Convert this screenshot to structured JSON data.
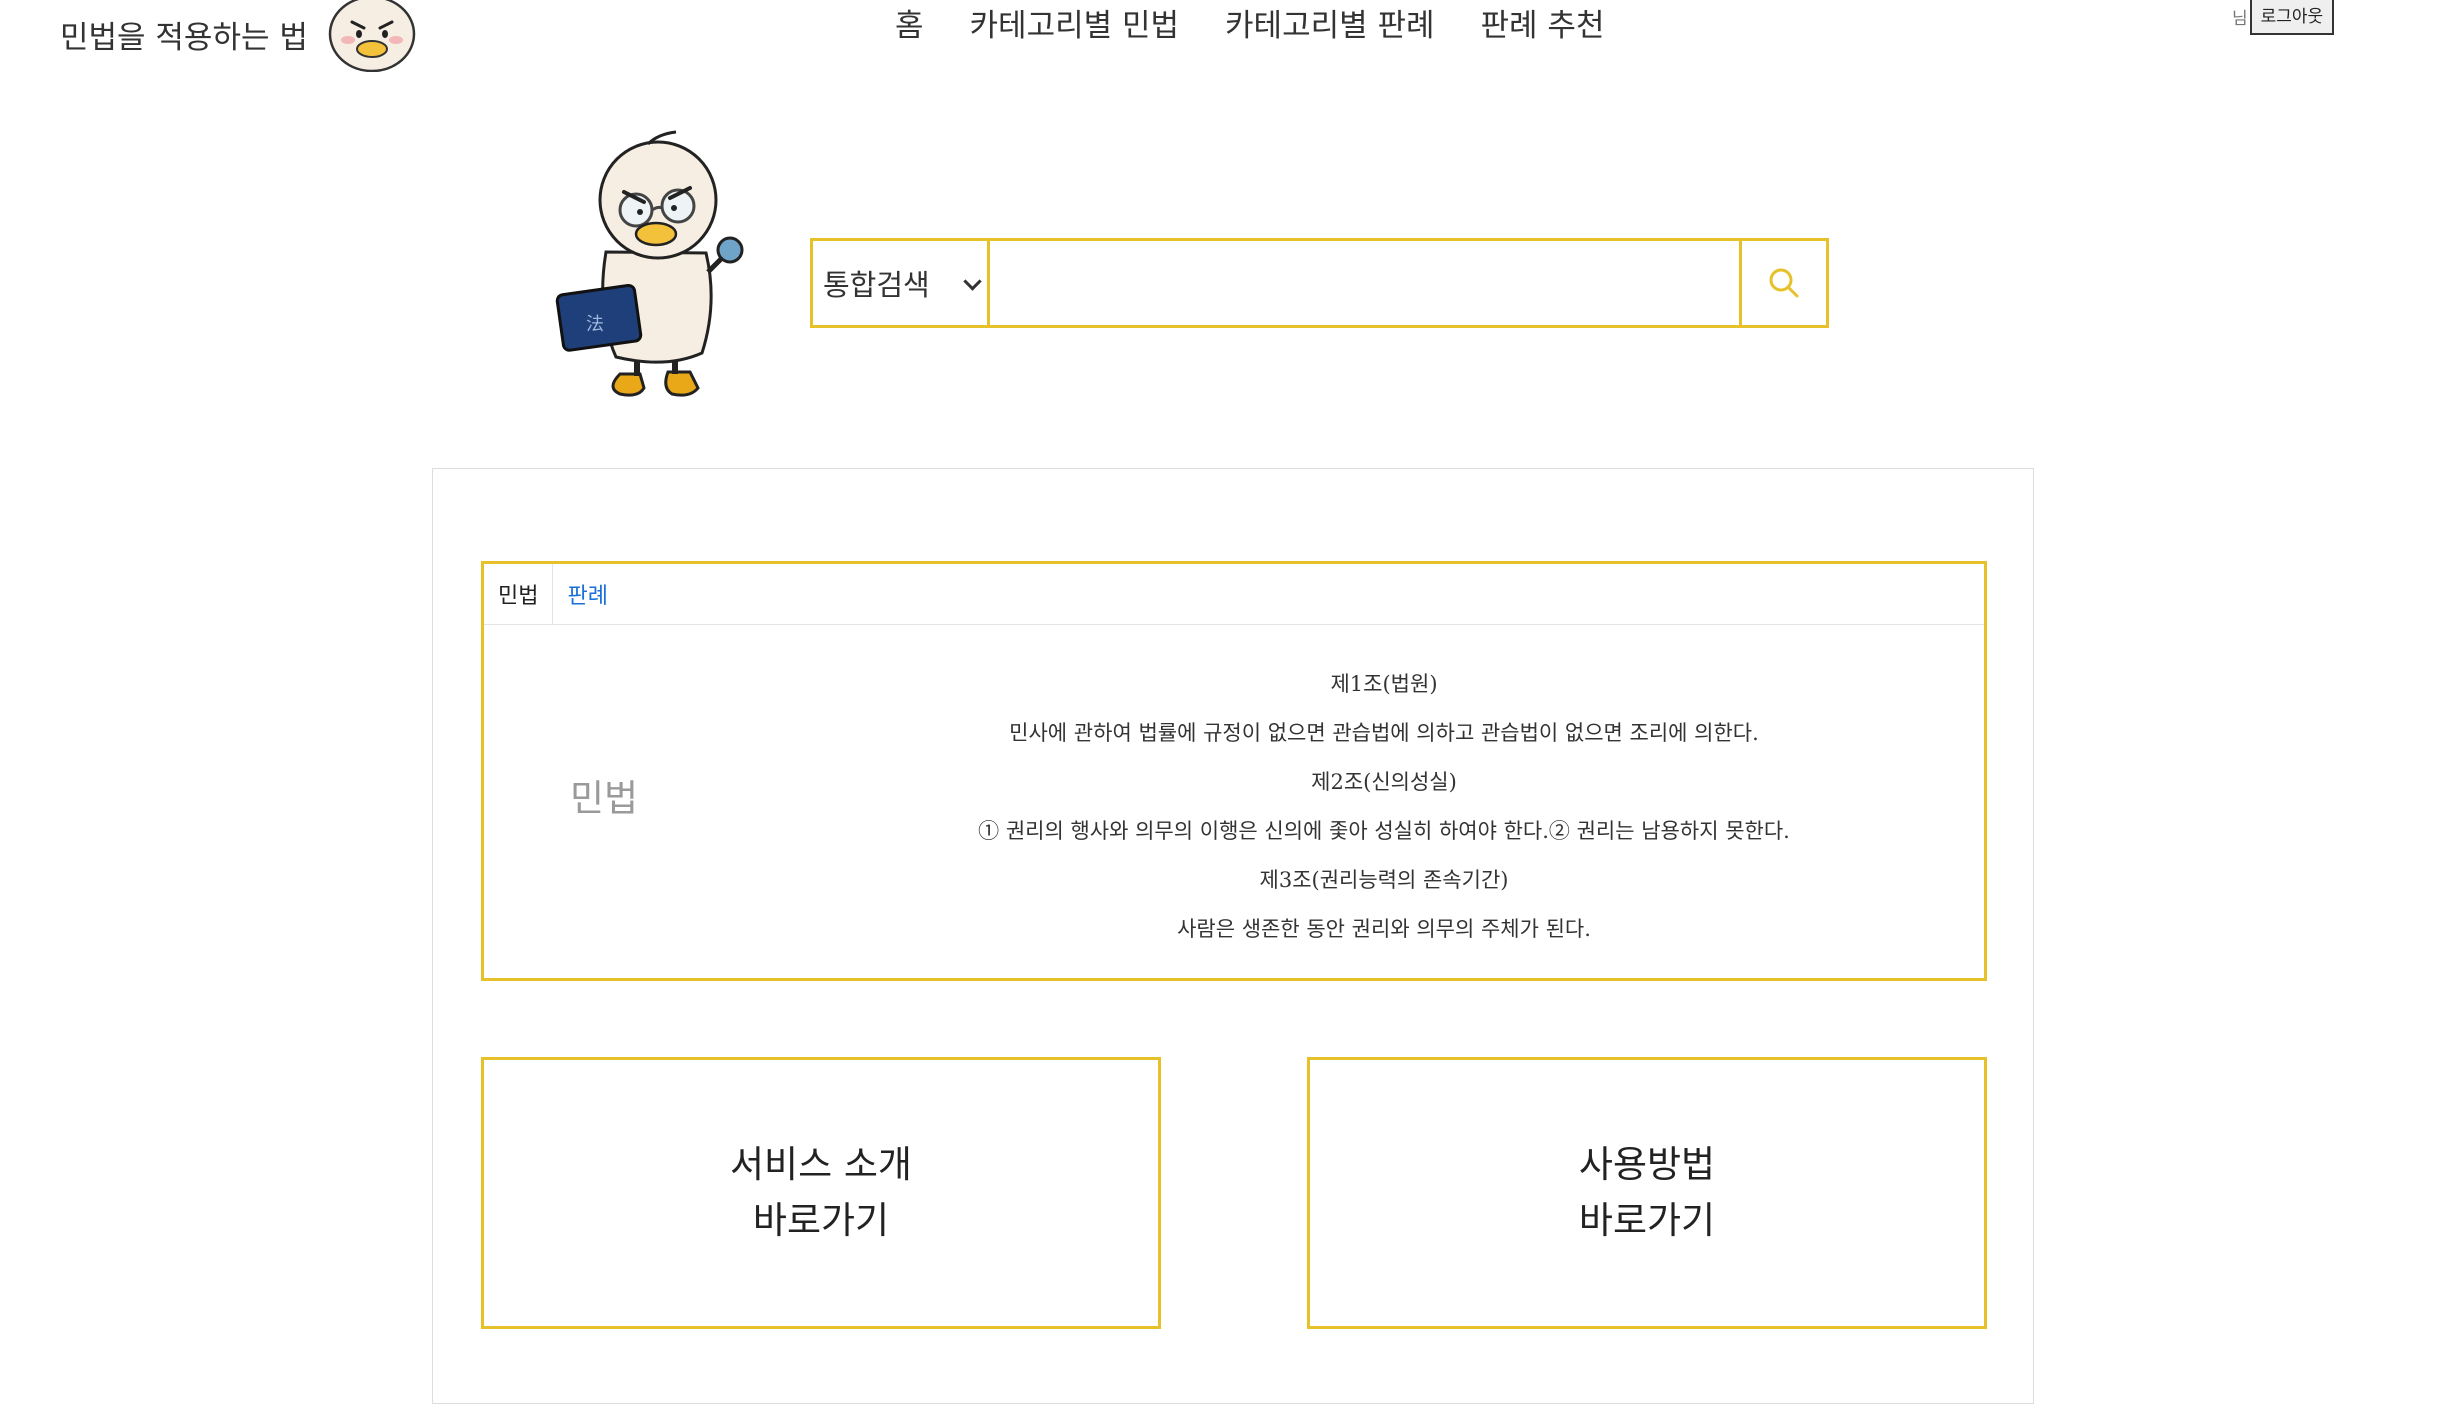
{
  "header": {
    "logo_text": "민법을 적용하는 법",
    "nav": [
      "홈",
      "카테고리별 민법",
      "카테고리별 판례",
      "판례 추천"
    ],
    "user_suffix": "님",
    "logout_label": "로그아웃"
  },
  "search": {
    "select_value": "통합검색",
    "input_value": "",
    "placeholder": ""
  },
  "law_box": {
    "tabs": [
      {
        "label": "민법",
        "active": true
      },
      {
        "label": "판례",
        "active": false
      }
    ],
    "side_label": "민법",
    "lines": [
      "제1조(법원)",
      "민사에 관하여 법률에 규정이 없으면 관습법에 의하고 관습법이 없으면 조리에 의한다.",
      "제2조(신의성실)",
      "① 권리의 행사와 의무의 이행은 신의에 좇아 성실히 하여야 한다.② 권리는 남용하지 못한다.",
      "제3조(권리능력의 존속기간)",
      "사람은 생존한 동안 권리와 의무의 주체가 된다."
    ]
  },
  "cards": [
    {
      "line1": "서비스 소개",
      "line2": "바로가기"
    },
    {
      "line1": "사용방법",
      "line2": "바로가기"
    }
  ],
  "colors": {
    "accent": "#e6c12a",
    "link": "#1a6fd8",
    "muted": "#9a9a9a"
  }
}
